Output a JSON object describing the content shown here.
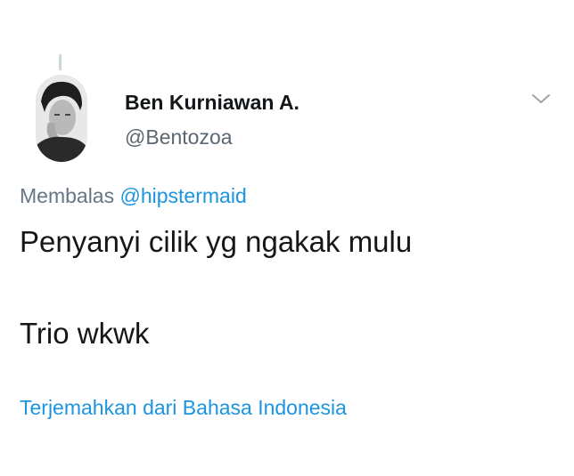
{
  "tweet": {
    "author": {
      "display_name": "Ben Kurniawan A.",
      "handle": "@Bentozoa",
      "avatar_icon": "user-photo-avatar"
    },
    "reply_context": {
      "prefix": "Membalas",
      "mention": "@hipstermaid"
    },
    "text_lines": [
      "Penyanyi cilik yg ngakak mulu",
      "Trio wkwk"
    ],
    "translate_link": "Terjemahkan dari Bahasa Indonesia",
    "menu_icon": "chevron-down-icon"
  },
  "colors": {
    "text_primary": "#14171a",
    "text_secondary": "#657786",
    "link": "#1b95e0",
    "thread_line": "#ccd6dd"
  }
}
